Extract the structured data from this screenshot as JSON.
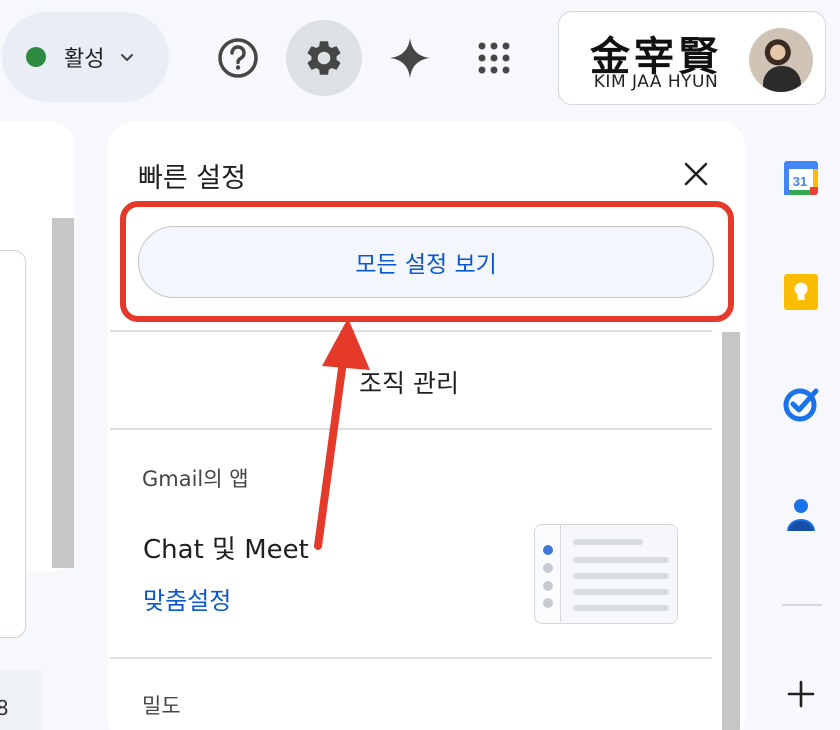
{
  "header": {
    "status_label": "활성",
    "account_name_hanja": "金宰賢",
    "account_name_roman": "KIM JAA HYUN",
    "icons": [
      "help-icon",
      "settings-icon",
      "gemini-icon",
      "apps-grid-icon"
    ]
  },
  "left_panel": {
    "partial_number": "8"
  },
  "quick_settings": {
    "title": "빠른 설정",
    "all_settings_label": "모든 설정 보기",
    "org_manage_label": "조직 관리",
    "apps_section_label": "Gmail의 앱",
    "chat_meet_label": "Chat 및 Meet",
    "customize_label": "맞춤설정",
    "density_label": "밀도"
  },
  "right_rail": {
    "calendar_day": "31",
    "icons": [
      "calendar-icon",
      "keep-icon",
      "tasks-icon",
      "contacts-icon",
      "add-icon"
    ]
  },
  "colors": {
    "accent_blue": "#0b57d0",
    "annotation_red": "#e53a2a",
    "status_green": "#2e8b3f",
    "background": "#f6f8fc"
  }
}
